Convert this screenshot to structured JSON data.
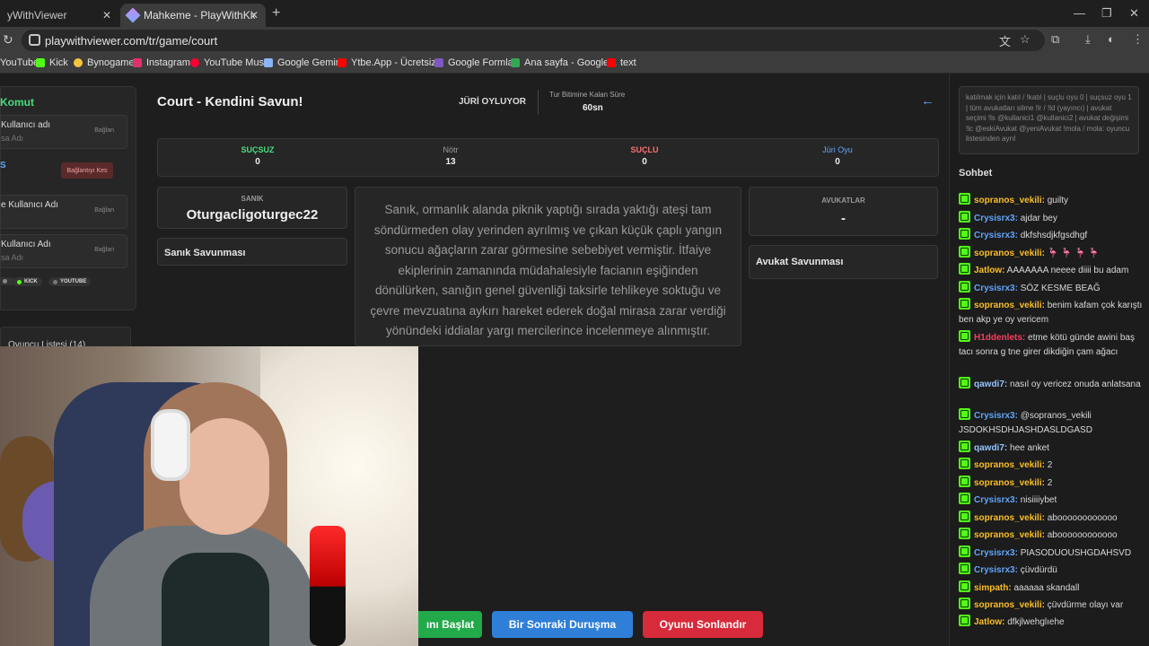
{
  "browser": {
    "tab1_title": "yWithViewer",
    "tab2_title": "Mahkeme - PlayWithKick | Play",
    "url": "playwithviewer.com/tr/game/court",
    "bookmarks": [
      "YouTube",
      "Kick",
      "Bynogame",
      "Instagram",
      "YouTube Music",
      "Google Gemini",
      "Ytbe.App - Ücretsiz...",
      "Google Formlar",
      "Ana sayfa - Google...",
      "text"
    ]
  },
  "left_panel": {
    "title": "Komut",
    "rows": [
      {
        "label": "Kullanıcı adı",
        "placeholder": "sa Adı",
        "button": "Bağlan"
      },
      {
        "label": "e Kullanıcı Adı",
        "placeholder": "",
        "button": "Bağlan"
      },
      {
        "label": "Kullanıcı Adı",
        "placeholder": "sa Adı",
        "button": "Bağlan"
      }
    ],
    "connected_label": "S",
    "disconnect_button": "Bağlantıyı Kes",
    "platforms": [
      "KICK",
      "YOUTUBE"
    ],
    "player_list": "Oyuncu Listesi (14)"
  },
  "header": {
    "title": "Court - Kendini Savun!",
    "phase": "JÜRİ OYLUYOR",
    "timer_label": "Tur Bitimine Kalan Süre",
    "timer_value": "60sn"
  },
  "stats": [
    {
      "label": "SUÇSUZ",
      "value": "0",
      "color": "#4ade80"
    },
    {
      "label": "Nötr",
      "value": "13",
      "color": "#9a9a9a"
    },
    {
      "label": "SUÇLU",
      "value": "0",
      "color": "#f87171"
    },
    {
      "label": "Jüri Oyu",
      "value": "0",
      "color": "#60a5fa"
    }
  ],
  "defendant": {
    "label": "SANIK",
    "name": "Oturgacligoturgec22",
    "defense_title": "Sanık Savunması"
  },
  "case_text": "Sanık, ormanlık alanda piknik yaptığı sırada yaktığı ateşi tam söndürmeden olay yerinden ayrılmış ve çıkan küçük çaplı yangın sonucu ağaçların zarar görmesine sebebiyet vermiştir. İtfaiye ekiplerinin zamanında müdahalesiyle facianın eşiğinden dönülürken, sanığın genel güvenliği taksirle tehlikeye soktuğu ve çevre mevzuatına aykırı hareket ederek doğal mirasa zarar verdiği yönündeki iddialar yargı mercilerince incelenmeye alınmıştır.",
  "lawyers": {
    "label": "AVUKATLAR",
    "value": "-",
    "defense_title": "Avukat Savunması"
  },
  "buttons": {
    "start": "ını Başlat",
    "next": "Bir Sonraki Duruşma",
    "end": "Oyunu Sonlandır"
  },
  "chat": {
    "commands": "katılmak için katıl / !katıl | suçlu oyu 0 | suçsuz oyu 1 | tüm avukatları silme !lr / !ld (yayıncı) | avukat seçimi !ls @kullanici1 @kullanici2 | avukat değişimi !lc @eskiAvukat @yeniAvukat !mola / mola: oyuncu listesinden ayrıl",
    "title": "Sohbet",
    "messages": [
      {
        "user": "sopranos_vekili",
        "text": "guilty",
        "color": "#fbbf24"
      },
      {
        "user": "Crysisrx3",
        "text": "ajdar bey",
        "color": "#60a5fa"
      },
      {
        "user": "Crysisrx3",
        "text": "dkfshsdjkfgsdhgf",
        "color": "#60a5fa"
      },
      {
        "user": "sopranos_vekili",
        "text": "🦩 🦩 🦩 🦩",
        "color": "#fbbf24"
      },
      {
        "user": "Jatlow",
        "text": "AAAAAAA neeee diiii bu adam",
        "color": "#fbbf24"
      },
      {
        "user": "Crysisrx3",
        "text": "SÖZ KESME BEAĞ",
        "color": "#60a5fa"
      },
      {
        "user": "sopranos_vekili",
        "text": "benim kafam çok karıştı ben akp ye oy vericem",
        "color": "#fbbf24"
      },
      {
        "user": "H1ddenlets",
        "text": "etme kötü günde awini baş tacı sonra g tne girer dikdiğin çam ağacı",
        "color": "#f43f5e"
      },
      {
        "user": "qawdi7",
        "text": "nasıl oy vericez onuda anlatsana",
        "color": "#93c5fd"
      },
      {
        "user": "Crysisrx3",
        "text": "@sopranos_vekili JSDOKHSDHJASHDASLDGASD",
        "color": "#60a5fa"
      },
      {
        "user": "qawdi7",
        "text": "hee anket",
        "color": "#93c5fd"
      },
      {
        "user": "sopranos_vekili",
        "text": "2",
        "color": "#fbbf24"
      },
      {
        "user": "sopranos_vekili",
        "text": "2",
        "color": "#fbbf24"
      },
      {
        "user": "Crysisrx3",
        "text": "nisiiiiybet",
        "color": "#60a5fa"
      },
      {
        "user": "sopranos_vekili",
        "text": "aboooooooooooo",
        "color": "#fbbf24"
      },
      {
        "user": "sopranos_vekili",
        "text": "aboooooooooooo",
        "color": "#fbbf24"
      },
      {
        "user": "Crysisrx3",
        "text": "PIASODUOUSHGDAHSVD",
        "color": "#60a5fa"
      },
      {
        "user": "Crysisrx3",
        "text": "çüvdürdü",
        "color": "#60a5fa"
      },
      {
        "user": "simpath",
        "text": "aaaaaa skandall",
        "color": "#fbbf24"
      },
      {
        "user": "sopranos_vekili",
        "text": "çüvdürme olayı var",
        "color": "#fbbf24"
      },
      {
        "user": "Jatlow",
        "text": "dfkjlwehglıehe",
        "color": "#fbbf24"
      }
    ]
  }
}
